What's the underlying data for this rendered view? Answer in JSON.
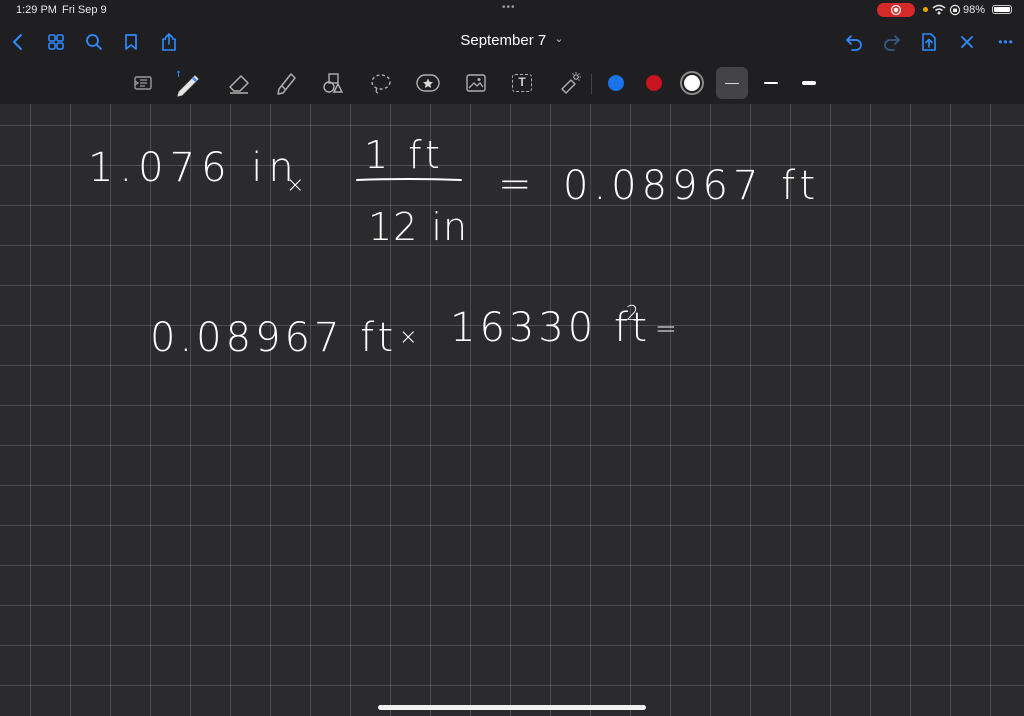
{
  "status_bar": {
    "time": "1:29 PM",
    "date": "Fri Sep 9",
    "battery_percent": "98%",
    "battery_level": 0.98
  },
  "nav": {
    "document_title": "September 7",
    "title_chevron": "⌄",
    "more_glyph": "•••"
  },
  "toolbar": {
    "text_tool_glyph": "T",
    "colors": [
      "#1a73e8",
      "#c8141e",
      "#ffffff"
    ],
    "accent": "#2f8bff"
  },
  "canvas": {
    "background": "#2b2b2d",
    "handwriting": {
      "line1_left": "1.076 in",
      "line1_times": "×",
      "line1_numerator": "1 ft",
      "line1_denominator": "12 in",
      "line1_equals": "=",
      "line1_result": "0.08967 ft",
      "line2_left": "0.08967 ft",
      "line2_times": "×",
      "line2_value": "16330 ft",
      "line2_exponent": "2",
      "line2_equals": "="
    }
  }
}
